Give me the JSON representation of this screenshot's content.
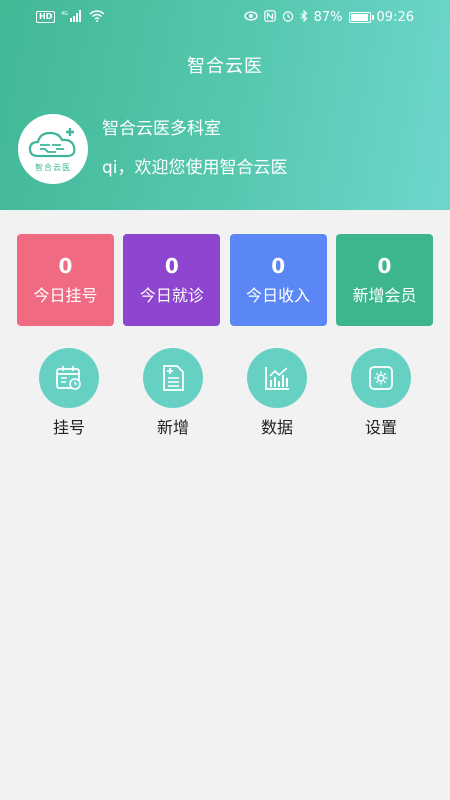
{
  "status_bar": {
    "hd": "HD",
    "network": "4G",
    "battery_percent": "87%",
    "time": "09:26",
    "battery_level": 0.87
  },
  "header": {
    "title": "智合云医",
    "clinic_name": "智合云医多科室",
    "welcome": "qi，欢迎您使用智合云医",
    "logo_text": "智合云医"
  },
  "stats": [
    {
      "value": "0",
      "label": "今日挂号",
      "color": "#f06b82"
    },
    {
      "value": "0",
      "label": "今日就诊",
      "color": "#8e45cf"
    },
    {
      "value": "0",
      "label": "今日收入",
      "color": "#5b87f5"
    },
    {
      "value": "0",
      "label": "新增会员",
      "color": "#3db58f"
    }
  ],
  "actions": [
    {
      "label": "挂号",
      "icon": "calendar-icon"
    },
    {
      "label": "新增",
      "icon": "document-add-icon"
    },
    {
      "label": "数据",
      "icon": "chart-icon"
    },
    {
      "label": "设置",
      "icon": "settings-icon"
    }
  ],
  "colors": {
    "header_start": "#41b896",
    "header_end": "#6ed7cd",
    "action_circle": "#66d1c3",
    "background": "#f2f2f2"
  }
}
